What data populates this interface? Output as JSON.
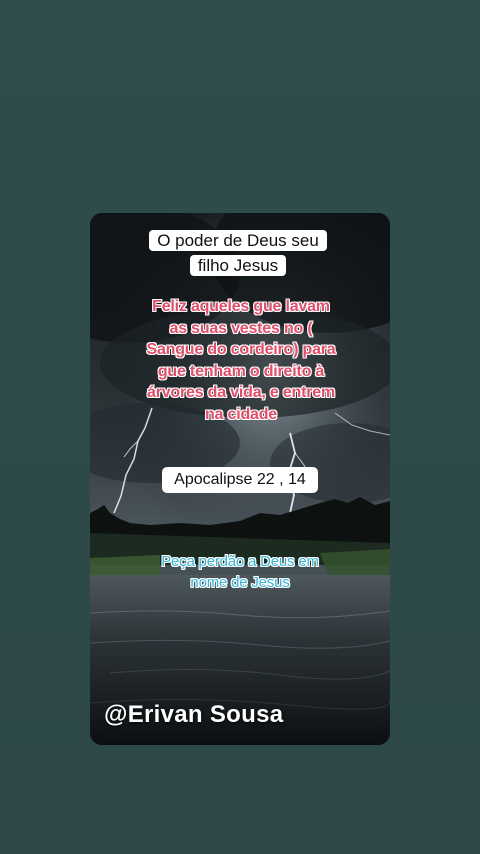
{
  "post": {
    "title": "O poder de Deus seu filho Jesus",
    "verse": "Feliz aqueles  gue lavam as suas vestes no ( Sangue do cordeiro) para  gue tenham  o direito  à árvores da vida,  e entrem na cidade",
    "reference": "Apocalipse 22 , 14",
    "plea": "Peça  perdão a Deus em nome de Jesus",
    "watermark": "@Erivan Sousa"
  },
  "colors": {
    "page_background": "#2f4d4a",
    "verse_text": "#e0506b",
    "plea_text": "#3ab5d6"
  }
}
